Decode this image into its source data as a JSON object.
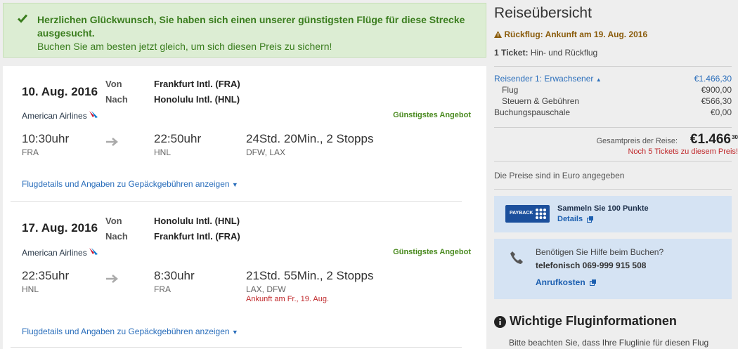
{
  "banner": {
    "title": "Herzlichen Glückwunsch, Sie haben sich einen unserer günstigsten Flüge für diese Strecke ausgesucht.",
    "subtitle": "Buchen Sie am besten jetzt gleich, um sich diesen Preis zu sichern!"
  },
  "segments": [
    {
      "date": "10. Aug. 2016",
      "from_label": "Von",
      "to_label": "Nach",
      "from_airport": "Frankfurt Intl. (FRA)",
      "to_airport": "Honolulu Intl. (HNL)",
      "airline": "American Airlines",
      "badge": "Günstigstes Angebot",
      "dep_time": "10:30uhr",
      "dep_code": "FRA",
      "arr_time": "22:50uhr",
      "arr_code": "HNL",
      "duration": "24Std. 20Min., 2 Stopps",
      "via": "DFW, LAX",
      "arrival_note": "",
      "details_link": "Flugdetails und Angaben zu Gepäckgebühren anzeigen"
    },
    {
      "date": "17. Aug. 2016",
      "from_label": "Von",
      "to_label": "Nach",
      "from_airport": "Honolulu Intl. (HNL)",
      "to_airport": "Frankfurt Intl. (FRA)",
      "airline": "American Airlines",
      "badge": "Günstigstes Angebot",
      "dep_time": "22:35uhr",
      "dep_code": "HNL",
      "arr_time": "8:30uhr",
      "arr_code": "FRA",
      "duration": "21Std. 55Min., 2 Stopps",
      "via": "LAX, DFW",
      "arrival_note": "Ankunft am Fr., 19. Aug.",
      "details_link": "Flugdetails und Angaben zu Gepäckgebühren anzeigen"
    }
  ],
  "summary": {
    "title": "Reiseübersicht",
    "warning": "Rückflug: Ankunft am 19. Aug. 2016",
    "tickets": "1 Ticket: Hin- und Rückflug",
    "traveler": {
      "label": "Reisender 1: Erwachsener",
      "value": "€1.466,30"
    },
    "flight": {
      "label": "Flug",
      "value": "€900,00"
    },
    "taxes": {
      "label": "Steuern & Gebühren",
      "value": "€566,30"
    },
    "booking_fee": {
      "label": "Buchungspauschale",
      "value": "€0,00"
    },
    "total_label": "Gesamtpreis der Reise:",
    "total_value": "€1.466",
    "total_cents": "30",
    "tickets_left": "Noch 5 Tickets zu diesem Preis!",
    "currency_note": "Die Preise sind in Euro angegeben"
  },
  "payback": {
    "logo_text": "PAYBACK",
    "title": "Sammeln Sie 100 Punkte",
    "link": "Details"
  },
  "help": {
    "question": "Benötigen Sie Hilfe beim Buchen?",
    "phone": "telefonisch 069-999 915 508",
    "link": "Anrufkosten"
  },
  "info": {
    "title": "Wichtige Fluginformationen",
    "text": "Bitte beachten Sie, dass Ihre Fluglinie für diesen Flug"
  },
  "colors": {
    "banner_bg": "#dcedd3",
    "banner_text": "#3a7d1e",
    "link_blue": "#2a6ebb",
    "alert_red": "#c0282b",
    "box_blue": "#d5e3f3"
  }
}
